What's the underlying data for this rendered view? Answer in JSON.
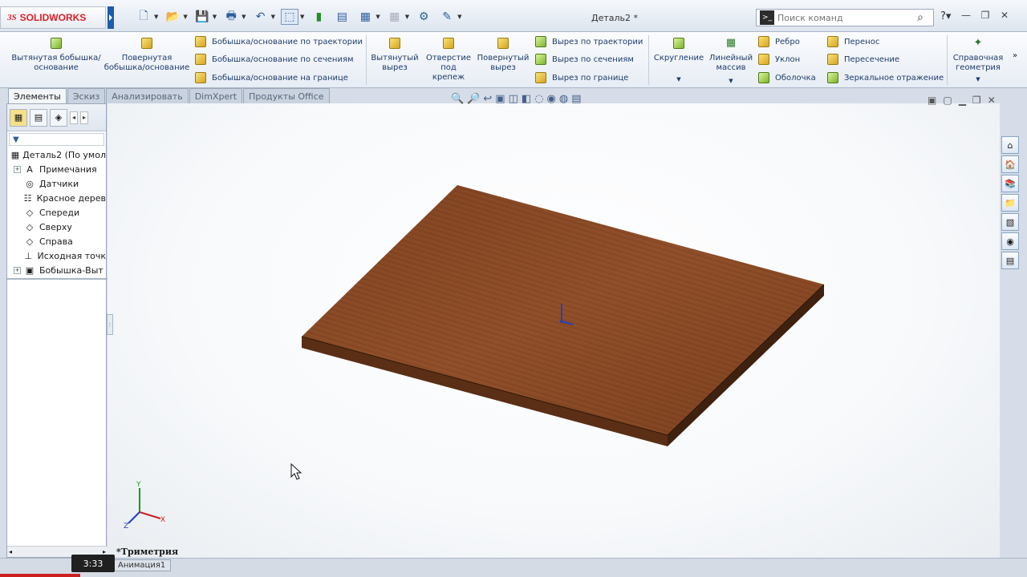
{
  "app": {
    "logo_ds": "3S",
    "logo_text": "SOLIDWORKS",
    "document_title": "Деталь2 *"
  },
  "search": {
    "placeholder": "Поиск команд"
  },
  "ribbon": {
    "extrude_boss": "Вытянутая бобышка/основание",
    "revolve_boss": "Повернутая бобышка/основание",
    "sweep_boss": "Бобышка/основание по траектории",
    "loft_boss": "Бобышка/основание по сечениям",
    "boundary_boss": "Бобышка/основание на границе",
    "extrude_cut": "Вытянутый вырез",
    "hole_wizard": "Отверстие под крепеж",
    "revolve_cut": "Повернутый вырез",
    "sweep_cut": "Вырез по траектории",
    "loft_cut": "Вырез по сечениям",
    "boundary_cut": "Вырез по границе",
    "fillet": "Скругление",
    "linear_pattern": "Линейный массив",
    "rib": "Ребро",
    "draft": "Уклон",
    "shell": "Оболочка",
    "wrap": "Перенос",
    "intersect": "Пересечение",
    "mirror": "Зеркальное отражение",
    "ref_geometry": "Справочная геометрия"
  },
  "tabs": [
    "Элементы",
    "Эскиз",
    "Анализировать",
    "DimXpert",
    "Продукты Office"
  ],
  "tree": [
    {
      "label": "Деталь2  (По умол",
      "icon": "part-icon",
      "expand": ""
    },
    {
      "label": "Примечания",
      "icon": "annotations-icon",
      "expand": "+"
    },
    {
      "label": "Датчики",
      "icon": "sensors-icon",
      "expand": ""
    },
    {
      "label": "Красное дерев",
      "icon": "material-icon",
      "expand": ""
    },
    {
      "label": "Спереди",
      "icon": "plane-icon",
      "expand": ""
    },
    {
      "label": "Сверху",
      "icon": "plane-icon",
      "expand": ""
    },
    {
      "label": "Справа",
      "icon": "plane-icon",
      "expand": ""
    },
    {
      "label": "Исходная точк",
      "icon": "origin-icon",
      "expand": ""
    },
    {
      "label": "Бобышка-Выт",
      "icon": "extrude-feature-icon",
      "expand": "+"
    }
  ],
  "viewport": {
    "view_name": "*Триметрия"
  },
  "status": {
    "animation_tab": "Анимация1",
    "video_time": "3:33"
  },
  "colors": {
    "wood_top": "#8a4a26",
    "wood_side": "#4f2a14",
    "accent": "#1e5ba8",
    "logo_red": "#d8232a"
  }
}
